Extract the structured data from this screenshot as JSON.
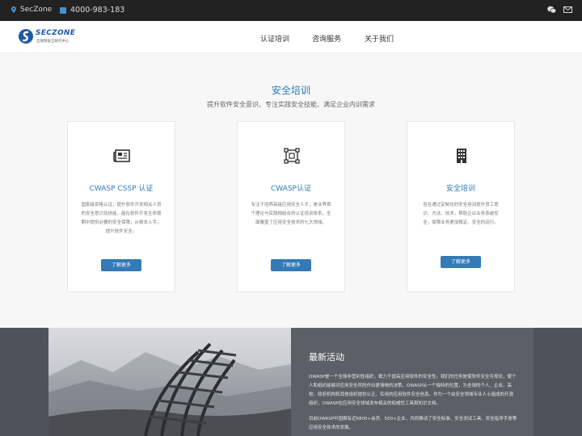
{
  "topbar": {
    "brand": "SecZone",
    "phone": "4000-983-183"
  },
  "header": {
    "logo_text": "SECZONE",
    "logo_sub": "互联网安全研究中心",
    "nav": [
      "认证培训",
      "咨询服务",
      "关于我们"
    ]
  },
  "training": {
    "title": "安全培训",
    "subtitle": "提升软件安全意识、专注实践安全技能、满足企业内训需求",
    "cards": [
      {
        "icon": "newspaper-icon",
        "title": "CWASP CSSP 认证",
        "desc": "国家级资格认证，提升软件开发相关人员的安全意识及技能，能在软件开发生命周期中提供必要的安全保障，从根本入手，提升软件安全。",
        "button": "了解更多"
      },
      {
        "icon": "selection-icon",
        "title": "CWASP认证",
        "desc": "专注于培养高级应用安全人才，是业界首个理论与实践相结合的认证培训体系，全面覆盖了应用安全技术的七大领域。",
        "button": "了解更多"
      },
      {
        "icon": "building-icon",
        "title": "安全培训",
        "desc": "旨在通过定制化的安全培训提升员工意识、方法、技术，帮助企业业务系统安全，保障业务更加稳定、安全的运行。",
        "button": "了解更多"
      }
    ]
  },
  "news": {
    "title": "最新活动",
    "p1": "OWASP是一个全球非营利性组织，致力于提高应用软件的安全性。我们的任务是使软件安全可视化，使个人和组织能够对应用安全风险作出更清晰的决策。OWASP从一个独特的位置，为全球的个人、企业、高校、政府机构和其他组织提供公正、实用的应用软件安全信息。作为一个由安全领域专业人士组成的开源组织，OWASP在应用安全领域发布相关的权威性工具和知识文档。",
    "p2": "目前OWASP中国拥有近6800+会员、500+企业，共同推动了安全标准、安全测试工具、安全指导手册等应用安全技术的发展。"
  }
}
